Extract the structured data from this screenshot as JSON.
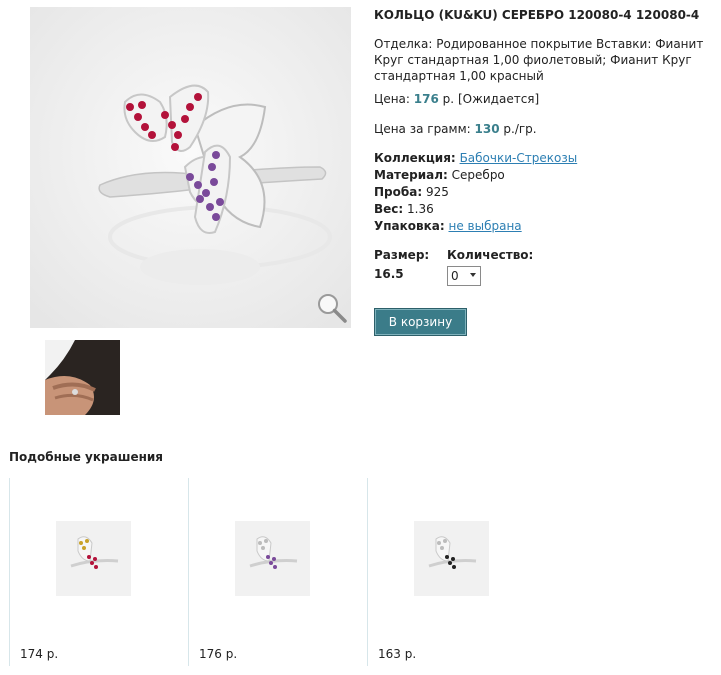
{
  "product": {
    "title": "КОЛЬЦО (KU&KU) СЕРЕБРО 120080-4 120080-4",
    "description": "Отделка: Родированное покрытие Вставки: Фианит Круг стандартная 1,00 фиолетовый; Фианит Круг стандартная 1,00 красный",
    "price_label": "Цена:",
    "price_value": "176",
    "price_currency": "р.",
    "price_status": "[Ожидается]",
    "gram_label": "Цена за грамм:",
    "gram_value": "130",
    "gram_unit": "р./гр."
  },
  "properties": {
    "collection_label": "Коллекция:",
    "collection_value": "Бабочки-Стрекозы",
    "material_label": "Материал:",
    "material_value": "Серебро",
    "assay_label": "Проба:",
    "assay_value": "925",
    "weight_label": "Вес:",
    "weight_value": "1.36",
    "packaging_label": "Упаковка:",
    "packaging_value": "не выбрана"
  },
  "order": {
    "size_label": "Размер:",
    "size_value": "16.5",
    "qty_label": "Количество:",
    "qty_value": "0",
    "cart_button": "В корзину"
  },
  "similar": {
    "title": "Подобные украшения",
    "items": [
      {
        "price": "174 р."
      },
      {
        "price": "176 р."
      },
      {
        "price": "163 р."
      }
    ]
  },
  "icons": {
    "zoom": "magnifier-icon"
  },
  "colors": {
    "accent": "#3a7f8c",
    "link": "#2d7fb3",
    "button_bg": "#3b7c89"
  }
}
